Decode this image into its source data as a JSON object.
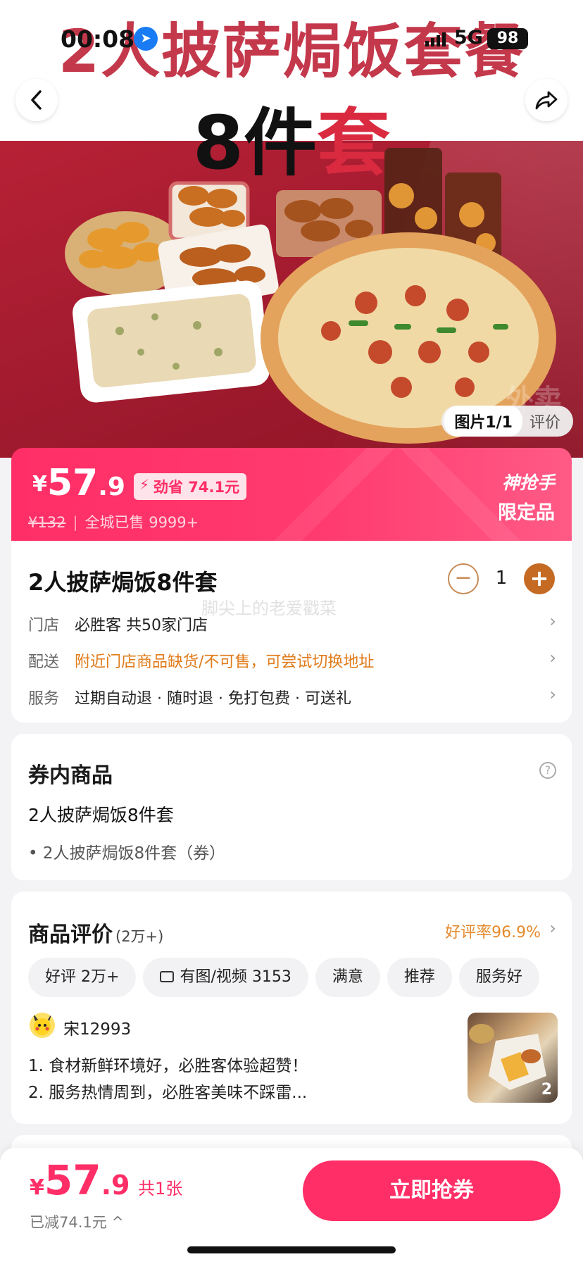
{
  "status_bar": {
    "time": "00:08",
    "network": "5G",
    "battery": "98"
  },
  "hero": {
    "title_line1": "2人披萨焗饭套餐",
    "title_line2_a": "8件",
    "title_line2_b": "套",
    "watermark": "外卖",
    "image_counter": {
      "active": "图片1/1",
      "other": "评价"
    }
  },
  "price_banner": {
    "currency": "¥",
    "price_int": "57",
    "price_dec": ".9",
    "save_label": "劲省 74.1元",
    "original_price": "¥132",
    "sold": "全城已售 9999+",
    "tag_line1": "神抢手",
    "tag_line2": "限定品"
  },
  "product": {
    "name": "2人披萨焗饭8件套",
    "quantity": "1",
    "faint_text": "脚尖上的老爱戳菜",
    "rows": [
      {
        "label": "门店",
        "value": "必胜客  共50家门店"
      },
      {
        "label": "配送",
        "value": "附近门店商品缺货/不可售，可尝试切换地址"
      },
      {
        "label": "服务",
        "value": "过期自动退 · 随时退 · 免打包费 · 可送礼"
      }
    ]
  },
  "coupon": {
    "title": "券内商品",
    "help_icon": "?",
    "item": "2人披萨焗饭8件套",
    "sub": "• 2人披萨焗饭8件套（券）"
  },
  "reviews": {
    "title": "商品评价",
    "count": "(2万+)",
    "rate": "好评率96.9%",
    "chips": [
      "好评 2万+",
      "有图/视频 3153",
      "满意",
      "推荐",
      "服务好"
    ],
    "user": "宋12993",
    "line1": "1. 食材新鲜环境好，必胜客体验超赞！",
    "line2": "2. 服务热情周到，必胜客美味不踩雷...",
    "thumb_count": "2"
  },
  "bottom": {
    "currency": "¥",
    "price_int": "57",
    "price_dec": ".9",
    "count": "共1张",
    "reduced": "已减74.1元 ^",
    "cta": "立即抢券"
  },
  "colors": {
    "accent": "#ff2e67",
    "orange": "#e07b1a",
    "stepper": "#c46a23"
  }
}
